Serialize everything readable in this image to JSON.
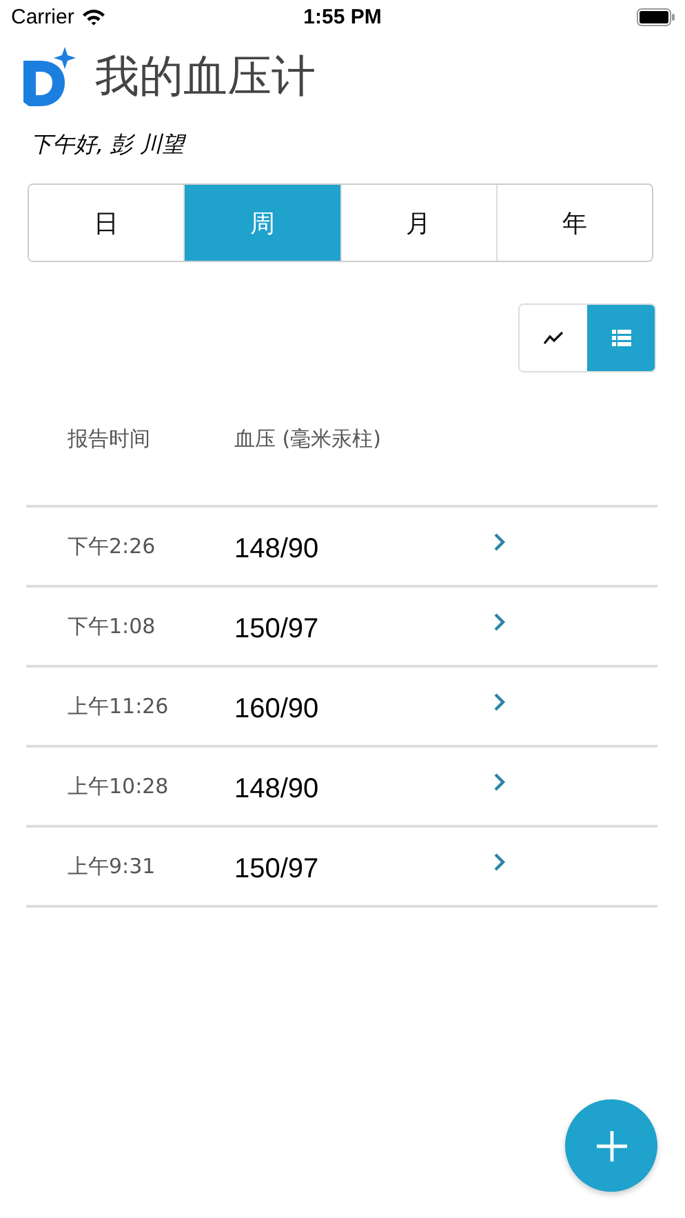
{
  "status_bar": {
    "carrier": "Carrier",
    "time": "1:55 PM"
  },
  "app_title": "我的血压计",
  "greeting": "下午好, 彭 川望",
  "period_tabs": [
    {
      "label": "日",
      "selected": false
    },
    {
      "label": "周",
      "selected": true
    },
    {
      "label": "月",
      "selected": false
    },
    {
      "label": "年",
      "selected": false
    }
  ],
  "view_toggle": [
    {
      "kind": "chart",
      "selected": false
    },
    {
      "kind": "list",
      "selected": true
    }
  ],
  "table": {
    "columns": [
      "报告时间",
      "血压 (毫米汞柱)"
    ],
    "rows": [
      {
        "time": "下午2:26",
        "pressure": "148/90"
      },
      {
        "time": "下午1:08",
        "pressure": "150/97"
      },
      {
        "time": "上午11:26",
        "pressure": "160/90"
      },
      {
        "time": "上午10:28",
        "pressure": "148/90"
      },
      {
        "time": "上午9:31",
        "pressure": "150/97"
      }
    ]
  }
}
